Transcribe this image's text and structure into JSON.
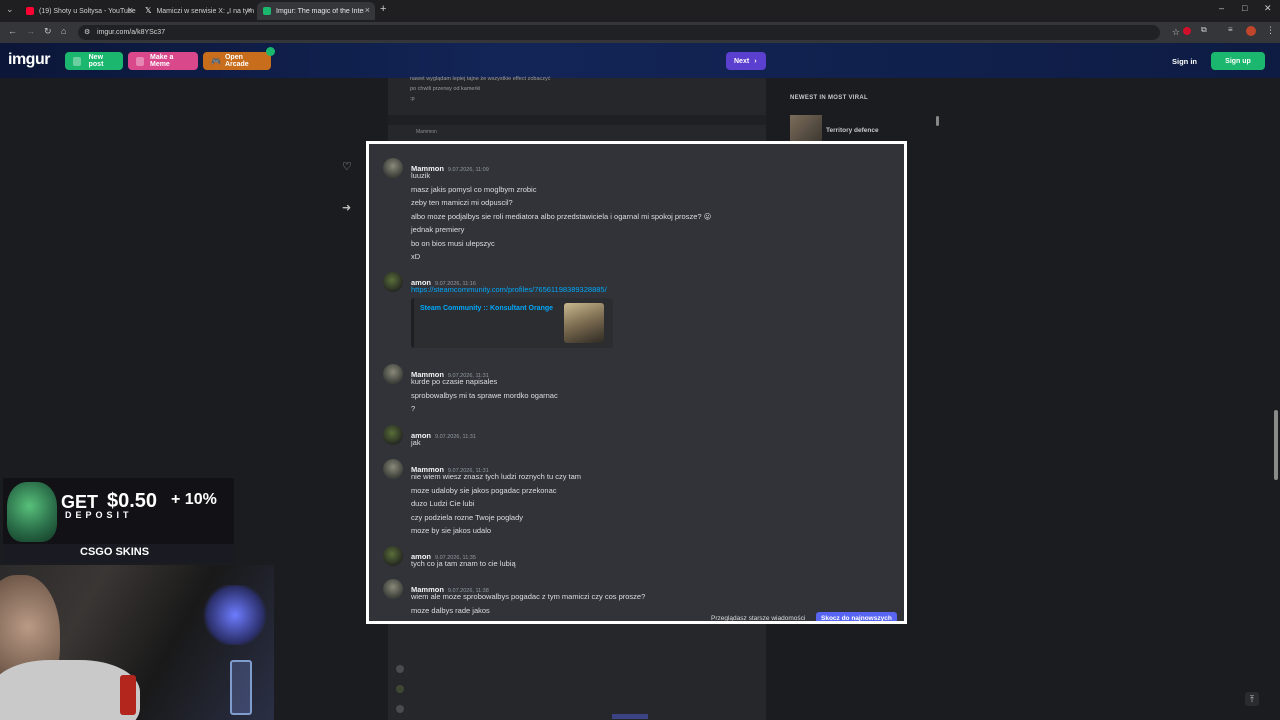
{
  "browser": {
    "tabs": [
      {
        "title": "(19) Shoty u Soltysa - YouTube",
        "fav_color": "#ff0033"
      },
      {
        "title": "Mamiczi w serwisie X: „I na tym",
        "fav_color": "#ffffff"
      },
      {
        "title": "Imgur: The magic of the Interne",
        "fav_color": "#1bb76e"
      }
    ],
    "new_tab": "+",
    "url": "imgur.com/a/k8YSc37"
  },
  "imgur": {
    "logo": "imgur",
    "new_post": "New post",
    "make_meme": "Make a Meme",
    "open_arcade": "Open Arcade",
    "next": "Next",
    "sign_in": "Sign in",
    "sign_up": "Sign up"
  },
  "background_post": {
    "lines": [
      "nawet wyglądam lepiej tajne że wszystkie effect zobaczyć",
      "po chwili przerwy od kamerki",
      ":p"
    ],
    "faded_author": "Mammon"
  },
  "sidebar": {
    "title": "NEWEST IN MOST VIRAL",
    "items": [
      {
        "title": "Territory defence"
      }
    ]
  },
  "chat": {
    "messages": [
      {
        "author": "Mammon",
        "avatar": "mammon",
        "time": "9.07.2026, 11:09",
        "lines": [
          "luuzik",
          "masz jakis pomysl co moglbym zrobic",
          "zeby ten mamiczi mi odpuscil?",
          "albo moze podjalbys sie roli mediatora albo przedstawiciela i ogarnal mi spokoj prosze? 😛",
          "jednak premiery",
          "bo on bios musi ulepszyc",
          "xD"
        ]
      },
      {
        "author": "amon",
        "avatar": "amon",
        "time": "9.07.2026, 11:16",
        "link": "https://steamcommunity.com/profiles/76561198389328885/",
        "embed_title": "Steam Community :: Konsultant Orange"
      },
      {
        "author": "Mammon",
        "avatar": "mammon",
        "time": "9.07.2026, 11:31",
        "lines": [
          "kurde po czasie napisales",
          "sprobowalbys mi ta sprawe mordko ogarnac",
          "?"
        ]
      },
      {
        "author": "amon",
        "avatar": "amon",
        "time": "9.07.2026, 11:31",
        "lines": [
          "jak"
        ]
      },
      {
        "author": "Mammon",
        "avatar": "mammon",
        "time": "9.07.2026, 11:31",
        "lines": [
          "nie wiem wiesz znasz tych ludzi roznych tu czy tam",
          "moze udaloby sie jakos pogadac przekonac",
          "duzo Ludzi Cie lubi",
          "czy podziela rozne Twoje poglady",
          "moze by sie jakos udalo"
        ]
      },
      {
        "author": "amon",
        "avatar": "amon",
        "time": "9.07.2026, 11:35",
        "lines": [
          "tych co ja tam znam to cie lubią"
        ]
      },
      {
        "author": "Mammon",
        "avatar": "mammon",
        "time": "9.07.2026, 11:38",
        "lines": [
          "wiem ale moze sprobowalbys pogadac z tym mamiczi czy cos prosze?",
          "moze dalbys rade jakos"
        ]
      }
    ],
    "older_notice": "Przeglądasz starsze wiadomości",
    "jump_button": "Skocz do najnowszych"
  },
  "ad": {
    "get": "GET",
    "amount": "$0.50",
    "plus": "+ 10%",
    "deposit": "DEPOSIT",
    "brand": "CSGO SKINS"
  },
  "colors": {
    "accent_green": "#1bb76e",
    "imgur_purple": "#6f4cd6",
    "discord_blurple": "#5865f2",
    "link_blue": "#00a8fc"
  }
}
